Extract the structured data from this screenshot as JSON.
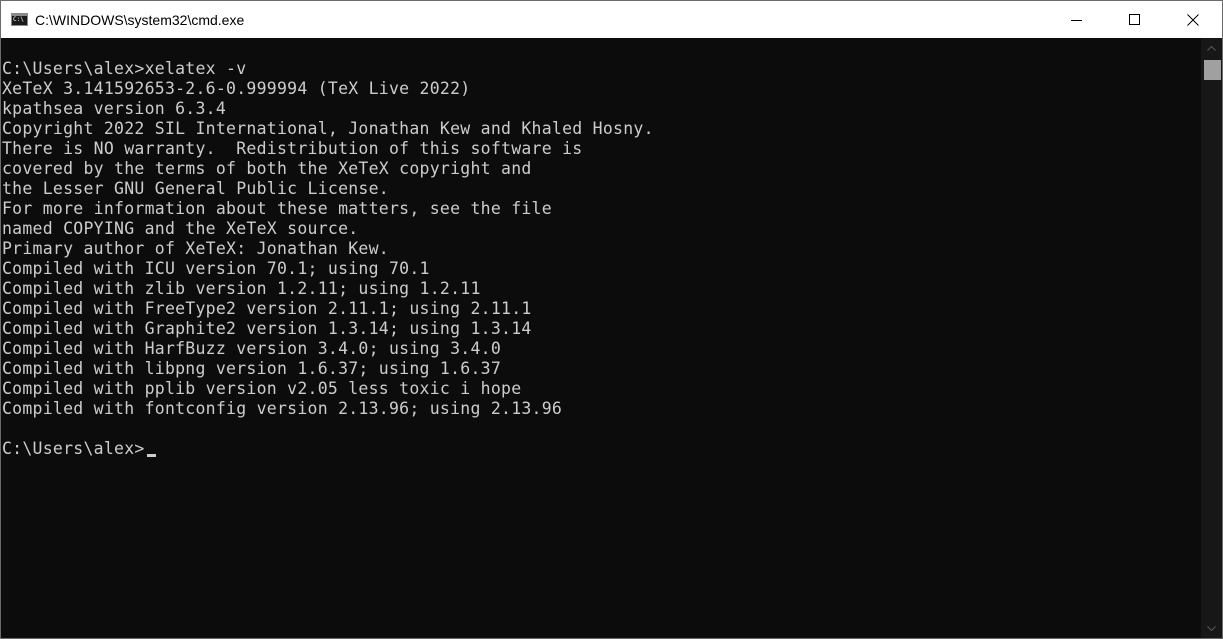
{
  "window": {
    "title": "C:\\WINDOWS\\system32\\cmd.exe",
    "icon": "cmd-app-icon",
    "icon_text": "C:\\",
    "buttons": {
      "minimize_icon": "minimize-icon",
      "maximize_icon": "maximize-icon",
      "close_icon": "close-icon"
    }
  },
  "console": {
    "text_color": "#cccccc",
    "background_color": "#0c0c0c",
    "lines": [
      "C:\\Users\\alex>xelatex -v",
      "XeTeX 3.141592653-2.6-0.999994 (TeX Live 2022)",
      "kpathsea version 6.3.4",
      "Copyright 2022 SIL International, Jonathan Kew and Khaled Hosny.",
      "There is NO warranty.  Redistribution of this software is",
      "covered by the terms of both the XeTeX copyright and",
      "the Lesser GNU General Public License.",
      "For more information about these matters, see the file",
      "named COPYING and the XeTeX source.",
      "Primary author of XeTeX: Jonathan Kew.",
      "Compiled with ICU version 70.1; using 70.1",
      "Compiled with zlib version 1.2.11; using 1.2.11",
      "Compiled with FreeType2 version 2.11.1; using 2.11.1",
      "Compiled with Graphite2 version 1.3.14; using 1.3.14",
      "Compiled with HarfBuzz version 3.4.0; using 3.4.0",
      "Compiled with libpng version 1.6.37; using 1.6.37",
      "Compiled with pplib version v2.05 less toxic i hope",
      "Compiled with fontconfig version 2.13.96; using 2.13.96",
      "",
      "C:\\Users\\alex>"
    ]
  },
  "scrollbar": {
    "position_fraction": 0.0
  }
}
